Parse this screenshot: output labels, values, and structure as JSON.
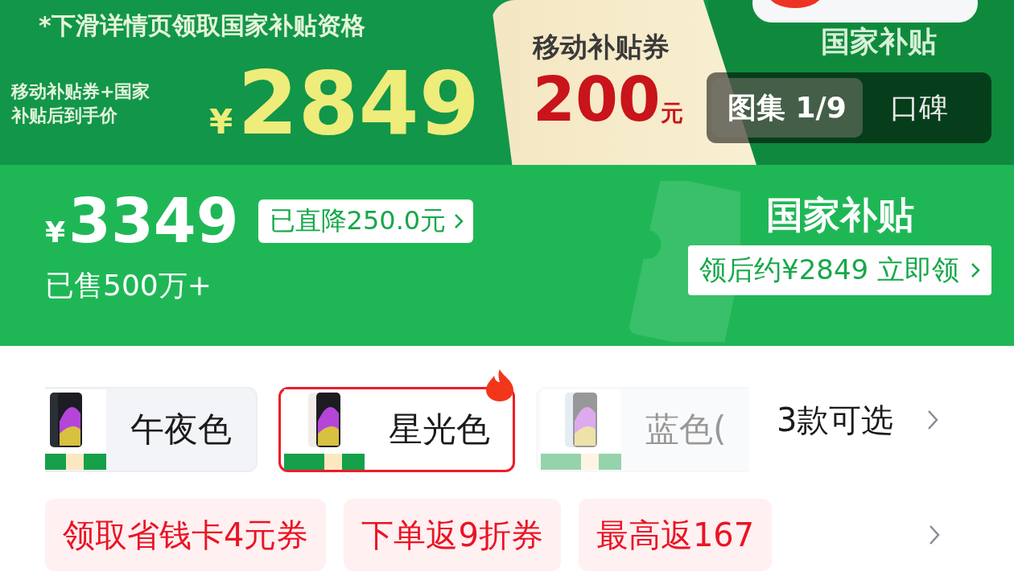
{
  "banner": {
    "notice": "*下滑详情页领取国家补贴资格",
    "caption_lines": [
      "移动补贴券+国家",
      "补贴后到手价"
    ],
    "currency": "¥",
    "price": "2849",
    "coupon": {
      "title": "移动补贴券",
      "amount": "200",
      "unit": "元"
    },
    "subsidy": {
      "title": "国家补贴"
    }
  },
  "gallery_tabs": [
    {
      "label": "图集 1/9",
      "selected": true
    },
    {
      "label": "口碑",
      "selected": false
    }
  ],
  "price_panel": {
    "currency": "¥",
    "price": "3349",
    "discount": "已直降250.0元",
    "sold": "已售500万+",
    "subsidy_title": "国家补贴",
    "subsidy_action": "领后约¥2849 立即领"
  },
  "variants": [
    {
      "name": "午夜色",
      "selected": false,
      "disabled": false,
      "hot": false
    },
    {
      "name": "星光色",
      "selected": true,
      "disabled": false,
      "hot": true
    },
    {
      "name": "蓝色(",
      "selected": false,
      "disabled": true,
      "hot": false
    }
  ],
  "variants_more": "3款可选",
  "coupons": [
    "领取省钱卡4元券",
    "下单返9折券",
    "最高返167"
  ]
}
